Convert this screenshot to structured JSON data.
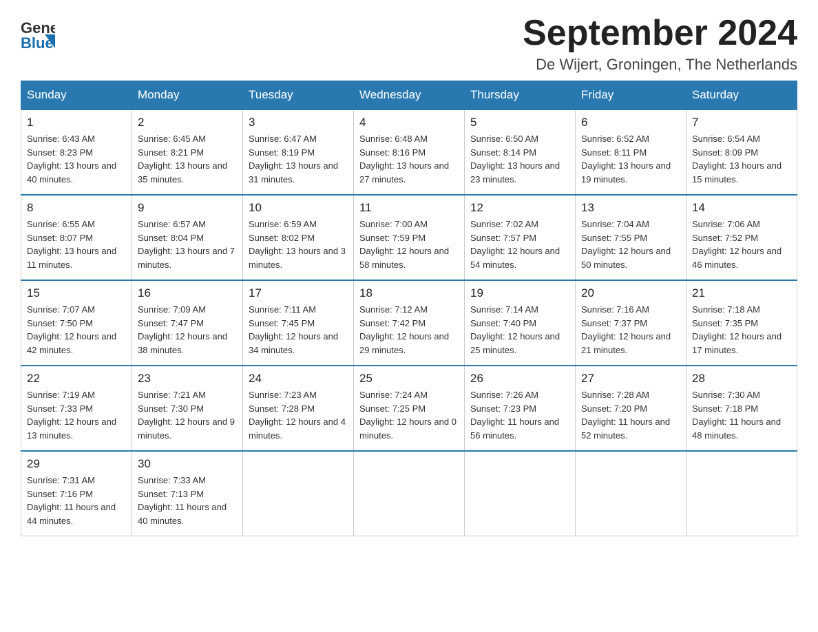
{
  "header": {
    "logo_general": "General",
    "logo_blue": "Blue",
    "month_title": "September 2024",
    "location": "De Wijert, Groningen, The Netherlands"
  },
  "weekdays": [
    "Sunday",
    "Monday",
    "Tuesday",
    "Wednesday",
    "Thursday",
    "Friday",
    "Saturday"
  ],
  "weeks": [
    [
      {
        "day": "1",
        "sunrise": "6:43 AM",
        "sunset": "8:23 PM",
        "daylight": "13 hours and 40 minutes."
      },
      {
        "day": "2",
        "sunrise": "6:45 AM",
        "sunset": "8:21 PM",
        "daylight": "13 hours and 35 minutes."
      },
      {
        "day": "3",
        "sunrise": "6:47 AM",
        "sunset": "8:19 PM",
        "daylight": "13 hours and 31 minutes."
      },
      {
        "day": "4",
        "sunrise": "6:48 AM",
        "sunset": "8:16 PM",
        "daylight": "13 hours and 27 minutes."
      },
      {
        "day": "5",
        "sunrise": "6:50 AM",
        "sunset": "8:14 PM",
        "daylight": "13 hours and 23 minutes."
      },
      {
        "day": "6",
        "sunrise": "6:52 AM",
        "sunset": "8:11 PM",
        "daylight": "13 hours and 19 minutes."
      },
      {
        "day": "7",
        "sunrise": "6:54 AM",
        "sunset": "8:09 PM",
        "daylight": "13 hours and 15 minutes."
      }
    ],
    [
      {
        "day": "8",
        "sunrise": "6:55 AM",
        "sunset": "8:07 PM",
        "daylight": "13 hours and 11 minutes."
      },
      {
        "day": "9",
        "sunrise": "6:57 AM",
        "sunset": "8:04 PM",
        "daylight": "13 hours and 7 minutes."
      },
      {
        "day": "10",
        "sunrise": "6:59 AM",
        "sunset": "8:02 PM",
        "daylight": "13 hours and 3 minutes."
      },
      {
        "day": "11",
        "sunrise": "7:00 AM",
        "sunset": "7:59 PM",
        "daylight": "12 hours and 58 minutes."
      },
      {
        "day": "12",
        "sunrise": "7:02 AM",
        "sunset": "7:57 PM",
        "daylight": "12 hours and 54 minutes."
      },
      {
        "day": "13",
        "sunrise": "7:04 AM",
        "sunset": "7:55 PM",
        "daylight": "12 hours and 50 minutes."
      },
      {
        "day": "14",
        "sunrise": "7:06 AM",
        "sunset": "7:52 PM",
        "daylight": "12 hours and 46 minutes."
      }
    ],
    [
      {
        "day": "15",
        "sunrise": "7:07 AM",
        "sunset": "7:50 PM",
        "daylight": "12 hours and 42 minutes."
      },
      {
        "day": "16",
        "sunrise": "7:09 AM",
        "sunset": "7:47 PM",
        "daylight": "12 hours and 38 minutes."
      },
      {
        "day": "17",
        "sunrise": "7:11 AM",
        "sunset": "7:45 PM",
        "daylight": "12 hours and 34 minutes."
      },
      {
        "day": "18",
        "sunrise": "7:12 AM",
        "sunset": "7:42 PM",
        "daylight": "12 hours and 29 minutes."
      },
      {
        "day": "19",
        "sunrise": "7:14 AM",
        "sunset": "7:40 PM",
        "daylight": "12 hours and 25 minutes."
      },
      {
        "day": "20",
        "sunrise": "7:16 AM",
        "sunset": "7:37 PM",
        "daylight": "12 hours and 21 minutes."
      },
      {
        "day": "21",
        "sunrise": "7:18 AM",
        "sunset": "7:35 PM",
        "daylight": "12 hours and 17 minutes."
      }
    ],
    [
      {
        "day": "22",
        "sunrise": "7:19 AM",
        "sunset": "7:33 PM",
        "daylight": "12 hours and 13 minutes."
      },
      {
        "day": "23",
        "sunrise": "7:21 AM",
        "sunset": "7:30 PM",
        "daylight": "12 hours and 9 minutes."
      },
      {
        "day": "24",
        "sunrise": "7:23 AM",
        "sunset": "7:28 PM",
        "daylight": "12 hours and 4 minutes."
      },
      {
        "day": "25",
        "sunrise": "7:24 AM",
        "sunset": "7:25 PM",
        "daylight": "12 hours and 0 minutes."
      },
      {
        "day": "26",
        "sunrise": "7:26 AM",
        "sunset": "7:23 PM",
        "daylight": "11 hours and 56 minutes."
      },
      {
        "day": "27",
        "sunrise": "7:28 AM",
        "sunset": "7:20 PM",
        "daylight": "11 hours and 52 minutes."
      },
      {
        "day": "28",
        "sunrise": "7:30 AM",
        "sunset": "7:18 PM",
        "daylight": "11 hours and 48 minutes."
      }
    ],
    [
      {
        "day": "29",
        "sunrise": "7:31 AM",
        "sunset": "7:16 PM",
        "daylight": "11 hours and 44 minutes."
      },
      {
        "day": "30",
        "sunrise": "7:33 AM",
        "sunset": "7:13 PM",
        "daylight": "11 hours and 40 minutes."
      },
      null,
      null,
      null,
      null,
      null
    ]
  ]
}
